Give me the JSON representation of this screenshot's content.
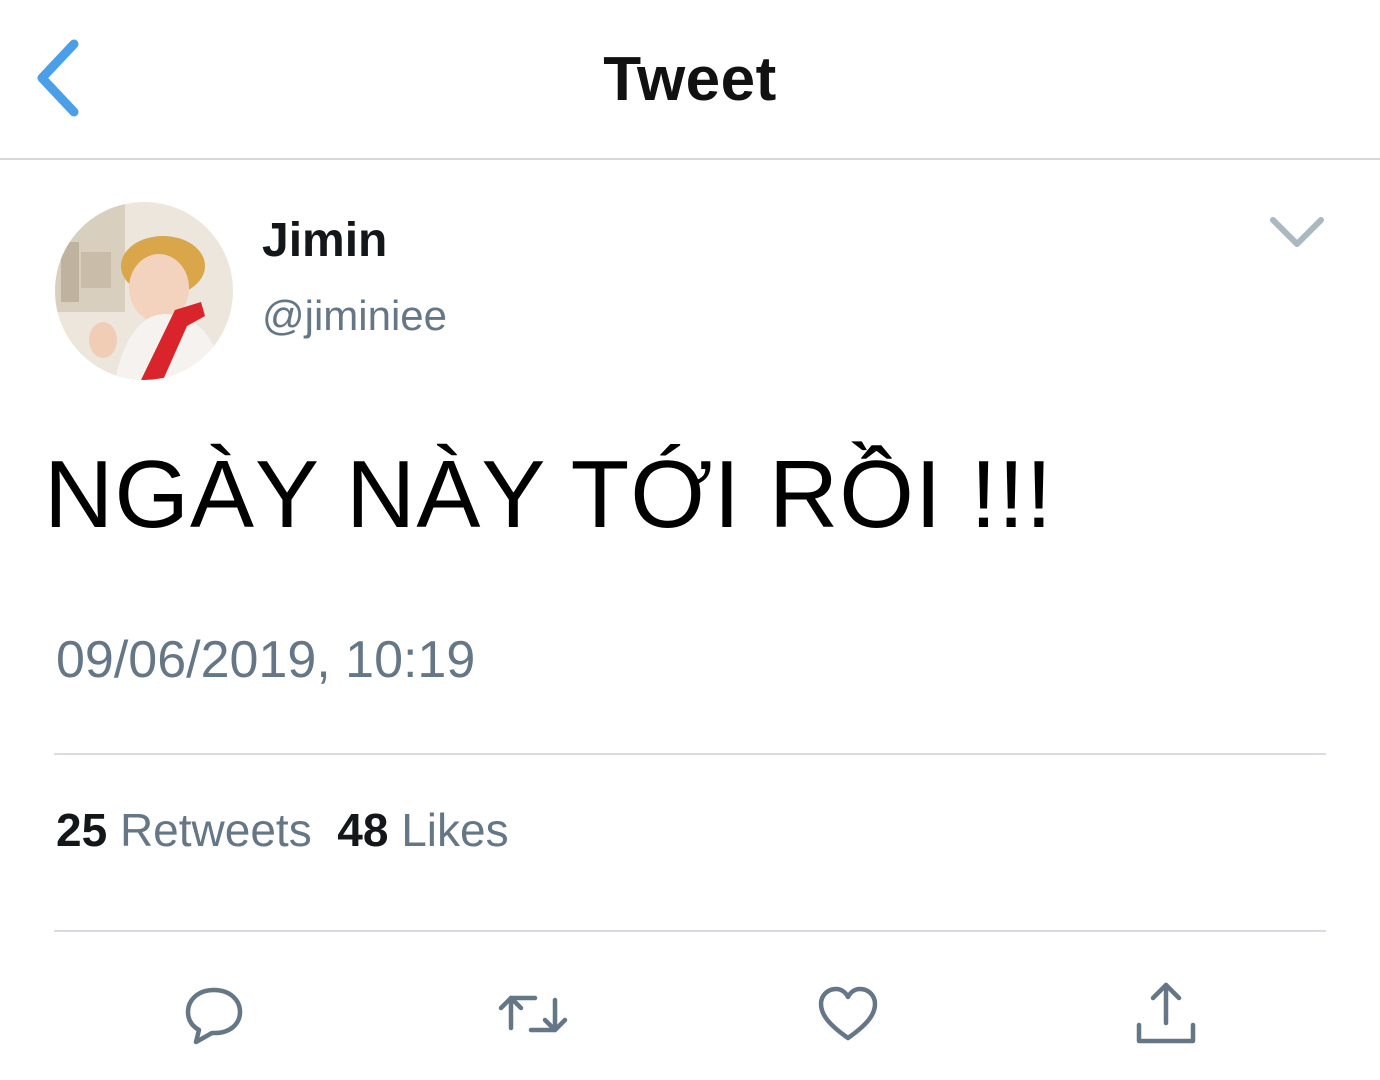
{
  "header": {
    "title": "Tweet",
    "back_icon": "chevron-left-icon",
    "accent_color": "#4a9fe8"
  },
  "author": {
    "name": "Jimin",
    "handle": "@jiminiee"
  },
  "tweet": {
    "text": "NGÀY NÀY TỚI RỒI !!!",
    "timestamp": "09/06/2019, 10:19"
  },
  "stats": {
    "retweets_count": "25",
    "retweets_label": "Retweets",
    "likes_count": "48",
    "likes_label": "Likes"
  },
  "actions": [
    "reply-icon",
    "retweet-icon",
    "heart-icon",
    "share-icon"
  ],
  "colors": {
    "text": "#14171a",
    "secondary": "#657786",
    "icon": "#657786",
    "divider": "#d8dce0"
  }
}
